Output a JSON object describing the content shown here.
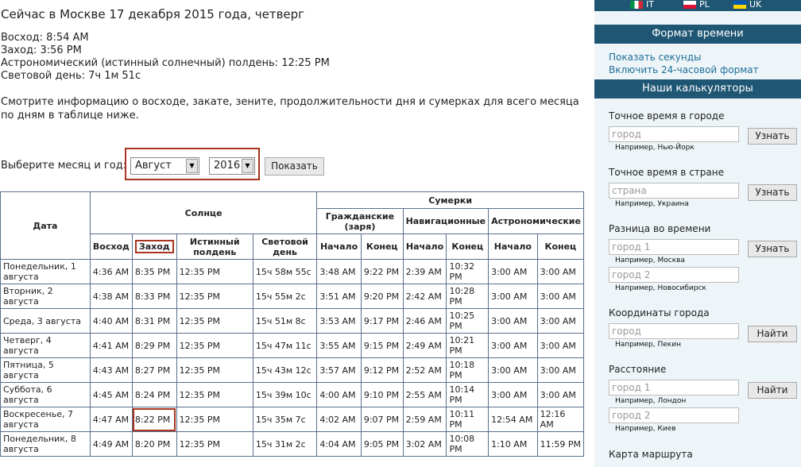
{
  "header": {
    "title": "Сейчас в Москве 17 декабря 2015 года, четверг",
    "sunrise": "Восход: 8:54 AM",
    "sunset": "Заход: 3:56 PM",
    "noon": "Астрономический (истинный солнечный) полдень: 12:25 PM",
    "daylength": "Световой день: 7ч 1м 51с",
    "info": "Смотрите информацию о восходе, закате, зените, продолжительности дня и сумерках для всего месяца по дням в таблице ниже."
  },
  "chooser": {
    "label": "Выберите месяц и год:",
    "month": "Август",
    "year": "2016",
    "show_button": "Показать"
  },
  "table": {
    "h_date": "Дата",
    "h_sun": "Солнце",
    "h_twilight": "Сумерки",
    "h_civil": "Гражданские (заря)",
    "h_nav": "Навигационные",
    "h_astro": "Астрономические",
    "h_rise": "Восход",
    "h_set": "Заход",
    "h_noon": "Истинный полдень",
    "h_length": "Световой день",
    "h_start": "Начало",
    "h_end": "Конец",
    "rows": [
      [
        "Понедельник, 1 августа",
        "4:36 AM",
        "8:35 PM",
        "12:35 PM",
        "15ч 58м 55с",
        "3:48 AM",
        "9:22 PM",
        "2:39 AM",
        "10:32 PM",
        "3:00 AM",
        "3:00 AM"
      ],
      [
        "Вторник, 2 августа",
        "4:38 AM",
        "8:33 PM",
        "12:35 PM",
        "15ч 55м 2с",
        "3:51 AM",
        "9:20 PM",
        "2:42 AM",
        "10:28 PM",
        "3:00 AM",
        "3:00 AM"
      ],
      [
        "Среда, 3 августа",
        "4:40 AM",
        "8:31 PM",
        "12:35 PM",
        "15ч 51м 8с",
        "3:53 AM",
        "9:17 PM",
        "2:46 AM",
        "10:25 PM",
        "3:00 AM",
        "3:00 AM"
      ],
      [
        "Четверг, 4 августа",
        "4:41 AM",
        "8:29 PM",
        "12:35 PM",
        "15ч 47м 11с",
        "3:55 AM",
        "9:15 PM",
        "2:49 AM",
        "10:21 PM",
        "3:00 AM",
        "3:00 AM"
      ],
      [
        "Пятница, 5 августа",
        "4:43 AM",
        "8:27 PM",
        "12:35 PM",
        "15ч 43м 12с",
        "3:57 AM",
        "9:12 PM",
        "2:52 AM",
        "10:18 PM",
        "3:00 AM",
        "3:00 AM"
      ],
      [
        "Суббота, 6 августа",
        "4:45 AM",
        "8:24 PM",
        "12:35 PM",
        "15ч 39м 10с",
        "4:00 AM",
        "9:10 PM",
        "2:55 AM",
        "10:14 PM",
        "3:00 AM",
        "3:00 AM"
      ],
      [
        "Воскресенье, 7 августа",
        "4:47 AM",
        "8:22 PM",
        "12:35 PM",
        "15ч 35м 7с",
        "4:02 AM",
        "9:07 PM",
        "2:59 AM",
        "10:11 PM",
        "12:54 AM",
        "12:16 AM"
      ],
      [
        "Понедельник, 8 августа",
        "4:49 AM",
        "8:20 PM",
        "12:35 PM",
        "15ч 31м 2с",
        "4:04 AM",
        "9:05 PM",
        "3:02 AM",
        "10:08 PM",
        "1:10 AM",
        "11:59 PM"
      ]
    ]
  },
  "sidebar": {
    "lang": [
      "IT",
      "PL",
      "UK"
    ],
    "time_format_title": "Формат времени",
    "show_seconds": "Показать секунды",
    "enable_24h": "Включить 24-часовой формат",
    "calculators_title": "Наши калькуляторы",
    "city_time_label": "Точное время в городе",
    "city_placeholder": "город",
    "city_example": "Например, Нью-Йорк",
    "country_time_label": "Точное время в стране",
    "country_placeholder": "страна",
    "country_example": "Например, Украина",
    "diff_label": "Разница во времени",
    "city1_placeholder": "город 1",
    "city1_example": "Например, Москва",
    "city2_placeholder": "город 2",
    "city2_example": "Например, Новосибирск",
    "coords_label": "Координаты города",
    "coords_example": "Например, Пекин",
    "distance_label": "Расстояние",
    "dist1_example": "Например, Лондон",
    "dist2_example": "Например, Киев",
    "route_label": "Карта маршрута",
    "find_button": "Узнать",
    "search_button": "Найти"
  },
  "colors": {
    "accent": "#1f5674",
    "highlight": "#a8331e",
    "link": "#1f6f98"
  }
}
